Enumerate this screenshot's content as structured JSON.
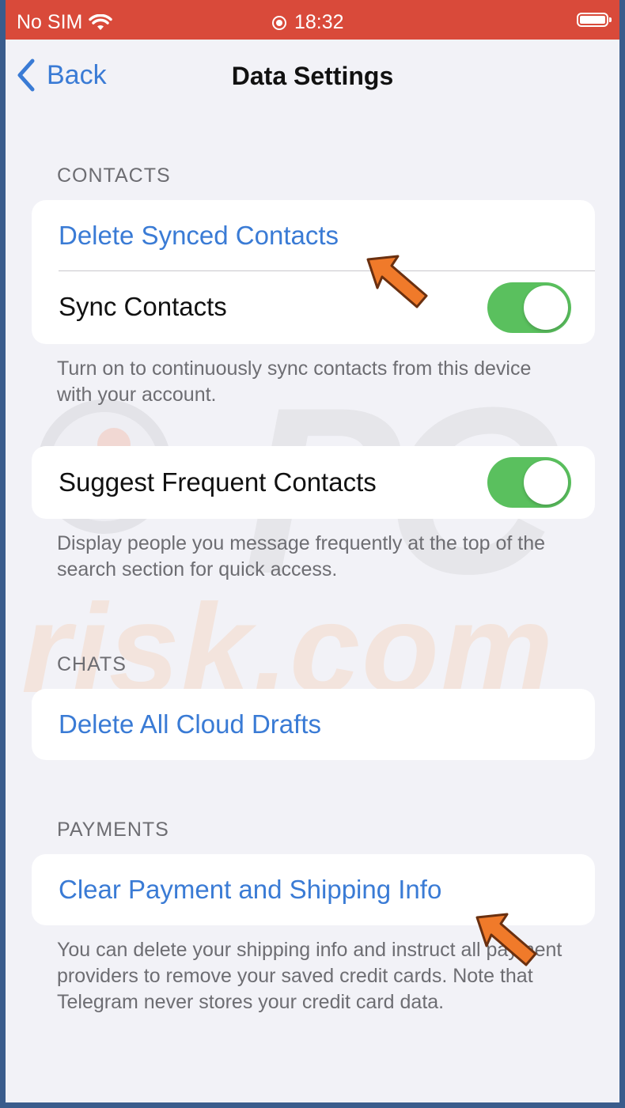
{
  "status_bar": {
    "carrier": "No SIM",
    "time": "18:32"
  },
  "nav": {
    "back_label": "Back",
    "title": "Data Settings"
  },
  "contacts": {
    "header": "CONTACTS",
    "delete_synced": "Delete Synced Contacts",
    "sync_contacts": "Sync Contacts",
    "sync_contacts_on": true,
    "sync_footer": "Turn on to continuously sync contacts from this device with your account.",
    "suggest_frequent": "Suggest Frequent Contacts",
    "suggest_frequent_on": true,
    "suggest_footer": "Display people you message frequently at the top of the search section for quick access."
  },
  "chats": {
    "header": "CHATS",
    "delete_drafts": "Delete All Cloud Drafts"
  },
  "payments": {
    "header": "PAYMENTS",
    "clear_info": "Clear Payment and Shipping Info",
    "footer": "You can delete your shipping info and instruct all payment providers to remove your saved credit cards. Note that Telegram never stores your credit card data."
  },
  "watermark": {
    "line1": "PC",
    "line2": "risk.com"
  },
  "colors": {
    "accent": "#3a7bd5",
    "toggle_on": "#5ac05e",
    "status_bar": "#d94a3a",
    "arrow": "#f07a2a"
  }
}
